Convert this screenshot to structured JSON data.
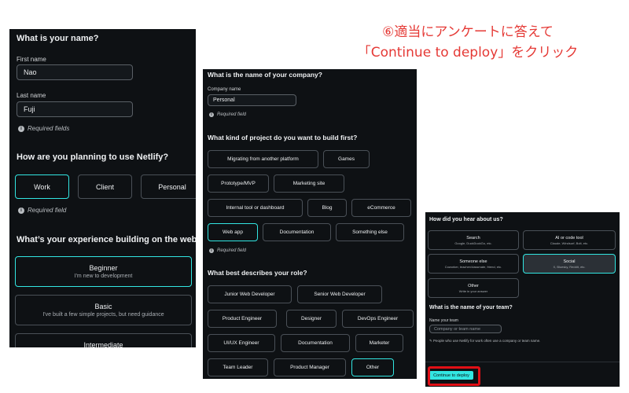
{
  "annotation": {
    "line1": "⑥適当にアンケートに答えて",
    "line2": "「Continue to deploy」をクリック"
  },
  "panel1": {
    "name_question": "What is your name?",
    "first_name_label": "First name",
    "first_name_value": "Nao",
    "last_name_label": "Last name",
    "last_name_value": "Fuji",
    "required_fields": "Required fields",
    "usage_question": "How are you planning to use Netlify?",
    "usage_options": [
      "Work",
      "Client",
      "Personal"
    ],
    "required_field": "Required field",
    "experience_question": "What’s your experience building on the web?",
    "experience_options": [
      {
        "title": "Beginner",
        "desc": "I'm new to development"
      },
      {
        "title": "Basic",
        "desc": "I've built a few simple projects, but need guidance"
      },
      {
        "title": "Intermediate",
        "desc": ""
      }
    ]
  },
  "panel2": {
    "company_question": "What is the name of your company?",
    "company_label": "Company name",
    "company_value": "Personal",
    "required_field": "Required field",
    "project_question": "What kind of project do you want to build first?",
    "project_options": [
      "Migrating from another platform",
      "Games",
      "Prototype/MVP",
      "Marketing site",
      "Internal tool or dashboard",
      "Blog",
      "eCommerce",
      "Web app",
      "Documentation",
      "Something else"
    ],
    "required_field_2": "Required field",
    "role_question": "What best describes your role?",
    "role_options": [
      "Junior Web Developer",
      "Senior Web Developer",
      "Product Engineer",
      "Designer",
      "DevOps Engineer",
      "UI/UX Engineer",
      "Documentation",
      "Marketer",
      "Team Leader",
      "Product Manager",
      "Other"
    ]
  },
  "panel3": {
    "hear_question": "How did you hear about us?",
    "hear_options": [
      {
        "title": "Search",
        "desc": "Google, DuckDuckGo, etc."
      },
      {
        "title": "AI or code tool",
        "desc": "Claude, Windsurf, Bolt, etc."
      },
      {
        "title": "Someone else",
        "desc": "Coworker, teacher/classmate, friend, etc."
      },
      {
        "title": "Social",
        "desc": "X, Bluesky, Reddit, etc."
      },
      {
        "title": "Other",
        "desc": "Write in your answer"
      }
    ],
    "team_question": "What is the name of your team?",
    "team_label": "Name your team",
    "team_placeholder": "Company or team name",
    "team_note": "People who use Netlify for work often use a company or team name.",
    "continue_label": "Continue to deploy"
  },
  "colors": {
    "accent": "#32e6e2",
    "panel_bg": "#0e1114",
    "annotation_red": "#e53935",
    "highlight_red": "#e10f16"
  }
}
